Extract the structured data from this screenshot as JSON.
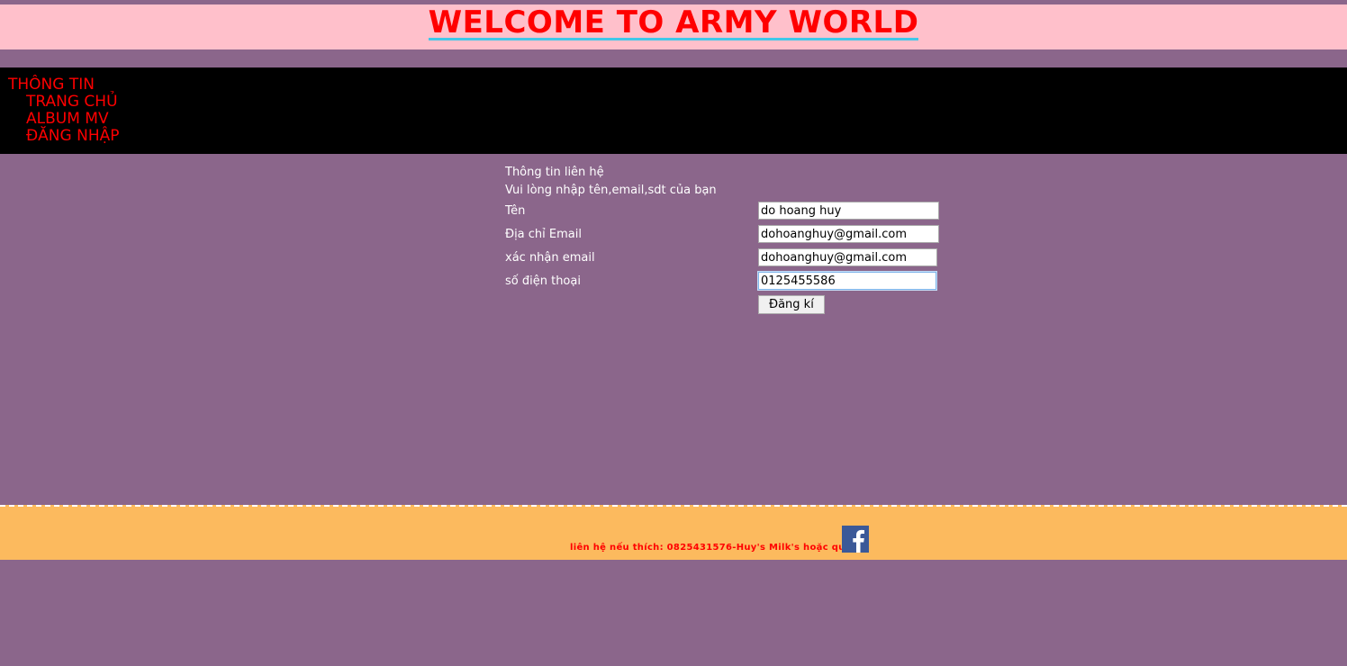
{
  "header": {
    "title": "WELCOME TO ARMY WORLD"
  },
  "nav": {
    "title": "THÔNG TIN",
    "items": [
      "TRANG CHỦ",
      "ALBUM MV",
      "ĐĂNG NHẬP"
    ]
  },
  "form": {
    "heading": "Thông tin liên hệ",
    "instruction": "Vui lòng nhập tên,email,sdt của bạn",
    "fields": [
      {
        "label": "Tên",
        "value": "do hoang huy"
      },
      {
        "label": "Địa chỉ Email",
        "value": "dohoanghuy@gmail.com"
      },
      {
        "label": "xác nhận email",
        "value": "dohoanghuy@gmail.com"
      },
      {
        "label": "số điện thoại",
        "value": "0125455586"
      }
    ],
    "submit_label": "Đăng kí"
  },
  "footer": {
    "text": "liên hệ nếu thích: 0825431576-Huy's Milk's hoặc qua",
    "icon": "facebook-icon"
  },
  "colors": {
    "background": "#8b668b",
    "header_bg": "#ffc0cb",
    "title": "#ff0000",
    "nav_bg": "#000000",
    "footer_bg": "#fcba5e"
  }
}
